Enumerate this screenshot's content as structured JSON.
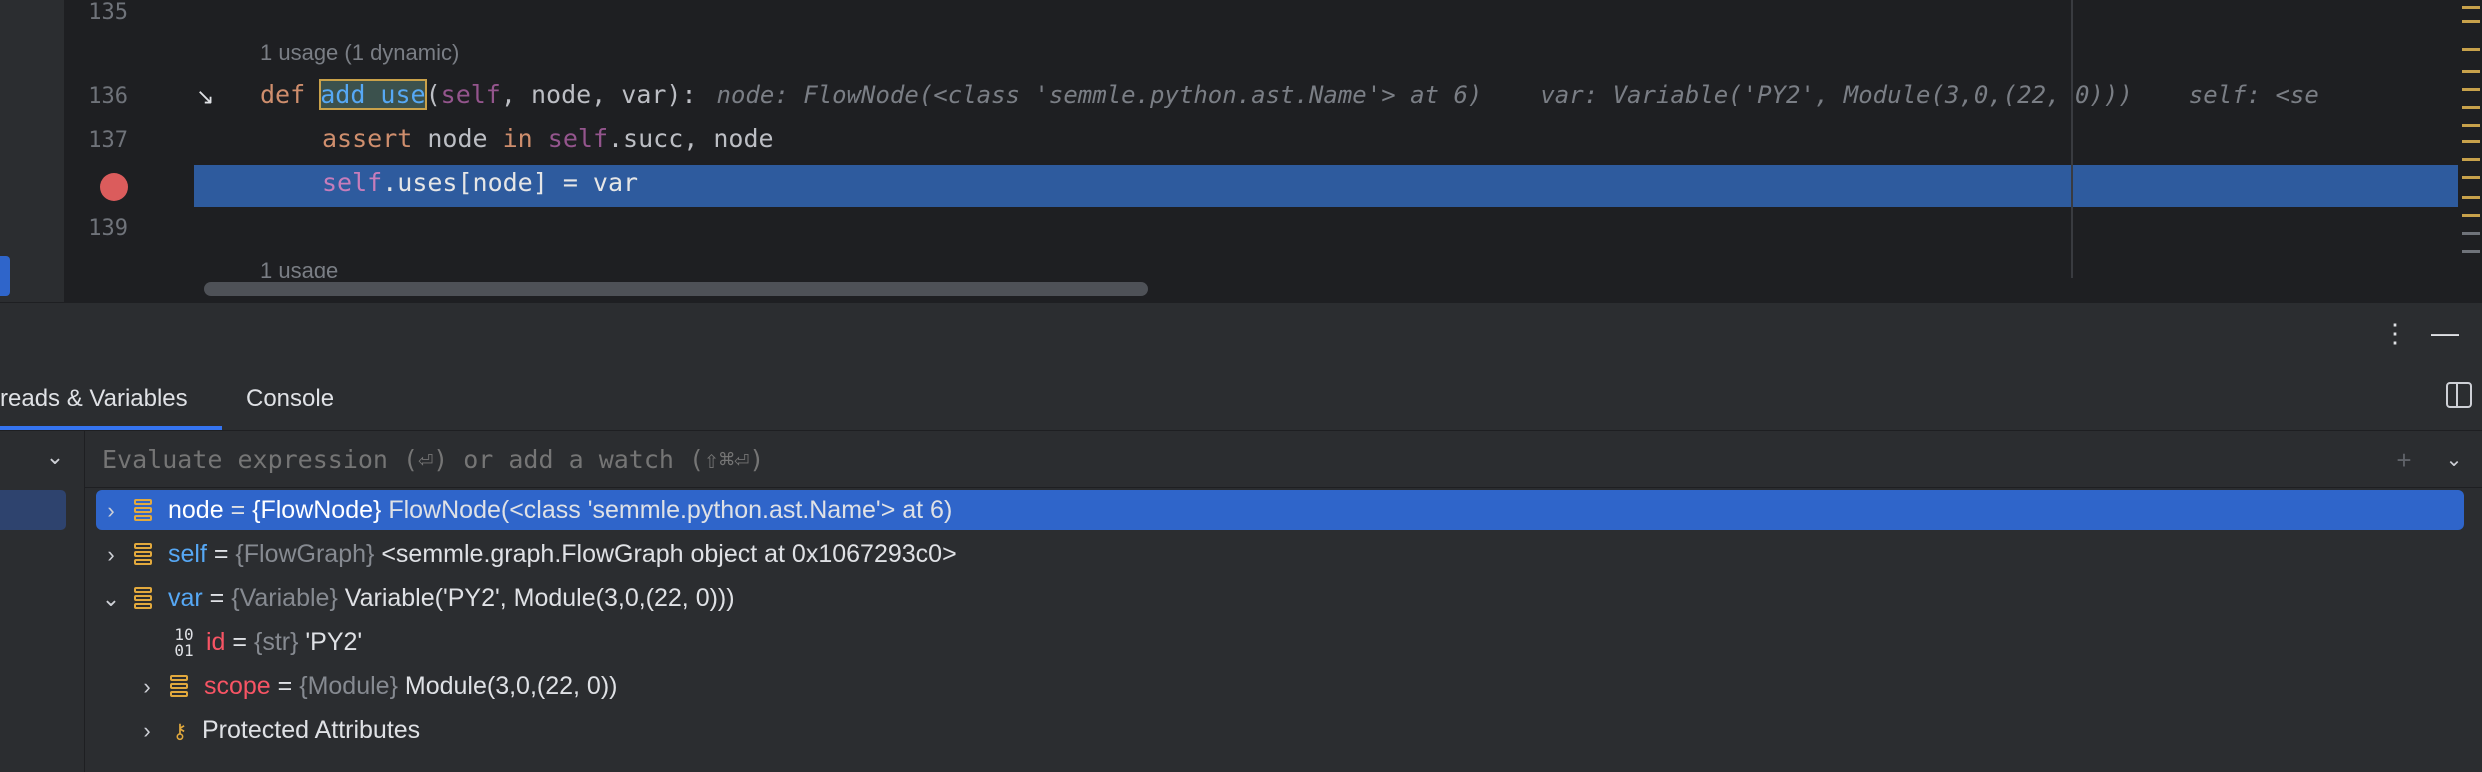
{
  "editor": {
    "lines": {
      "l135": "135",
      "l136": "136",
      "l137": "137",
      "l139": "139"
    },
    "lens_usage": "1 usage (1 dynamic)",
    "lens_usage_bottom": "1 usage",
    "line136": {
      "def": "def ",
      "fn": "add_use",
      "open": "(",
      "self": "self",
      "params": ", node, var):",
      "hint_node": "node: FlowNode(<class 'semmle.python.ast.Name'> at 6)",
      "hint_var": "var: Variable('PY2', Module(3,0,(22, 0)))",
      "hint_self": "self: <se"
    },
    "line137": {
      "kw": "assert",
      "a": " node ",
      "kw2": "in",
      "self": " self",
      "b": ".succ, node"
    },
    "line138": {
      "self": "self",
      "rest": ".uses[node] = var"
    }
  },
  "panel": {
    "more_icon": "⋮",
    "minimize_icon": "—",
    "tabs": {
      "threads": "reads & Variables",
      "console": "Console"
    }
  },
  "evaluate": {
    "placeholder": "Evaluate expression (⏎) or add a watch (⇧⌘⏎)"
  },
  "variables": [
    {
      "name": "node",
      "type": "{FlowNode}",
      "value": "FlowNode(<class 'semmle.python.ast.Name'> at 6)",
      "expanded": false
    },
    {
      "name": "self",
      "type": "{FlowGraph}",
      "value": "<semmle.graph.FlowGraph object at 0x1067293c0>",
      "expanded": false
    },
    {
      "name": "var",
      "type": "{Variable}",
      "value": "Variable('PY2', Module(3,0,(22, 0)))",
      "expanded": true
    },
    {
      "name": "id",
      "type": "{str}",
      "value": "'PY2'"
    },
    {
      "name": "scope",
      "type": "{Module}",
      "value": "Module(3,0,(22, 0))",
      "expanded": false
    },
    {
      "name": "Protected Attributes"
    }
  ],
  "eq": " = "
}
